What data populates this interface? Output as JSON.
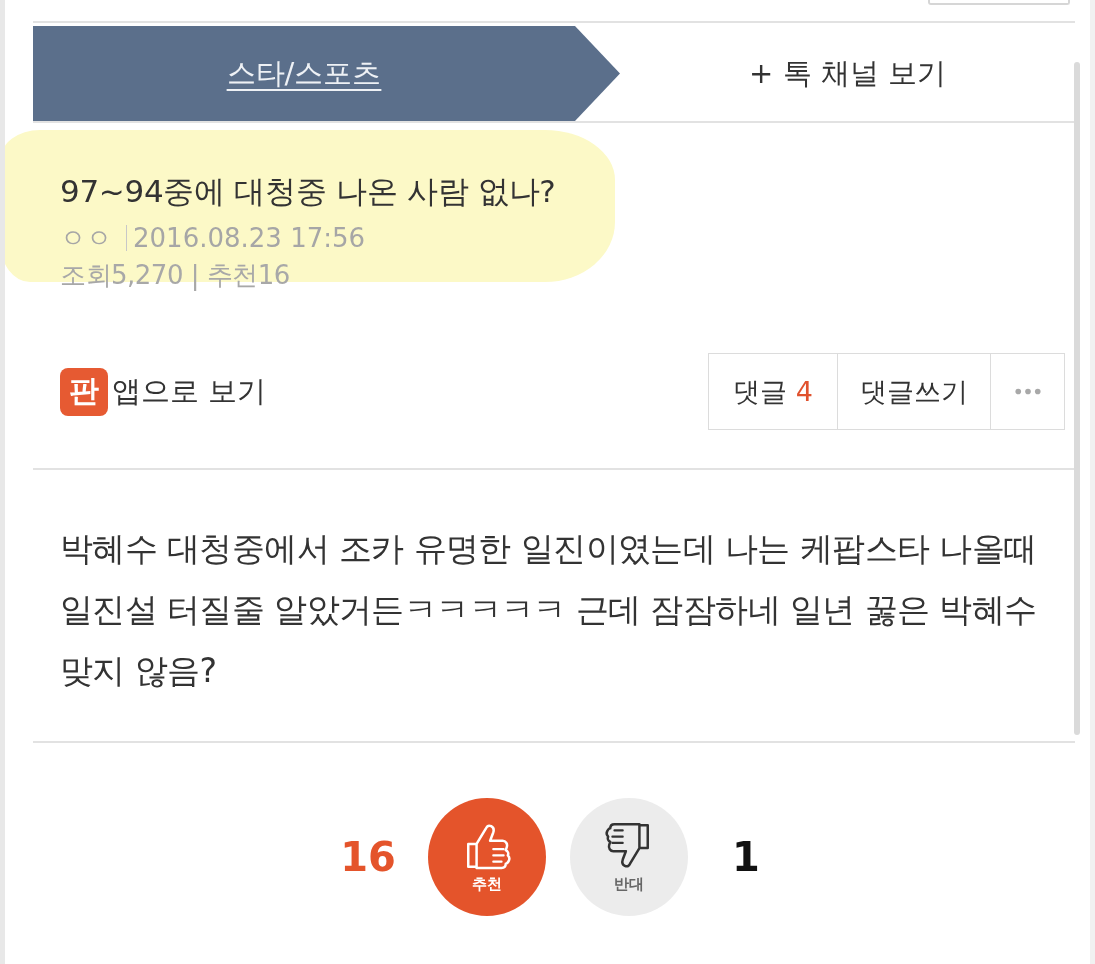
{
  "tabs": [
    {
      "label": "스타/스포츠",
      "selected": true
    },
    {
      "label": "+ 톡 채널 보기",
      "selected": false
    }
  ],
  "post": {
    "title": "97~94중에 대청중 나온 사람 없나?",
    "author": "ㅇㅇ",
    "date": "2016.08.23 17:56",
    "stats": "조회5,270 | 추천16"
  },
  "app_link": {
    "logo_text": "판",
    "label": "앱으로 보기"
  },
  "actions": [
    {
      "kind": "comments",
      "label": "댓글",
      "count": "4"
    },
    {
      "kind": "write",
      "label": "댓글쓰기"
    },
    {
      "kind": "more"
    }
  ],
  "body": "박혜수 대청중에서 조카 유명한 일진이였는데 나는 케팝스타 나올때 일진설 터질줄 알았거든ㅋㅋㅋㅋㅋ 근데 잠잠하네 일년 꿇은 박혜수 맞지 않음?",
  "votes": [
    {
      "kind": "up",
      "label": "추천",
      "count": "16"
    },
    {
      "kind": "down",
      "label": "반대",
      "count": "1"
    }
  ]
}
